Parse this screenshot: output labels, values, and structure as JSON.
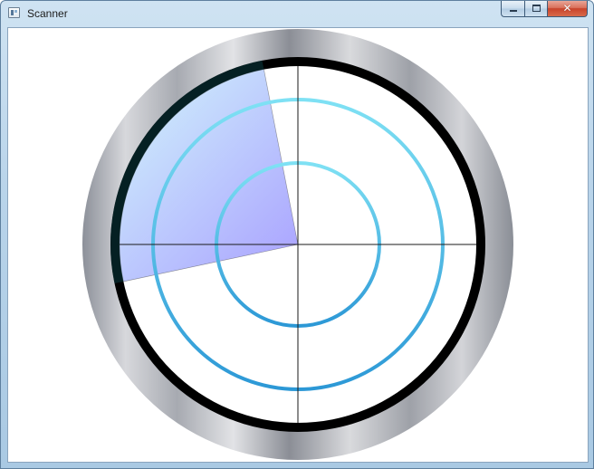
{
  "window": {
    "title": "Scanner",
    "app_icon": "window-app-icon",
    "buttons": {
      "minimize_icon": "minimize-icon",
      "maximize_icon": "maximize-icon",
      "close_icon": "close-icon"
    }
  },
  "scanner": {
    "colors": {
      "bezel_dark": "#8c9099",
      "bezel_light": "#e2e3e6",
      "outer_ring": "#000000",
      "ring_inner": "#2c98d6",
      "ring_outer": "#7fe1f4",
      "crosshair": "#1a1a1a",
      "sweep_start": "#9e98ff",
      "sweep_end": "#c8f1fb"
    },
    "sweep_start_deg": 259,
    "sweep_end_deg": 351,
    "ring_count": 2
  }
}
